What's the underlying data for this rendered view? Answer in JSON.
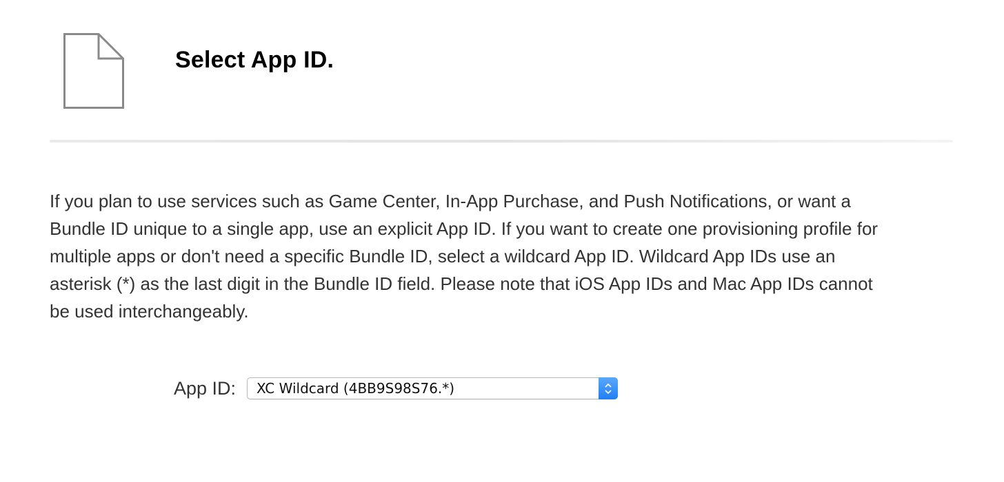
{
  "header": {
    "icon": "document-icon",
    "title": "Select App ID."
  },
  "description": "If you plan to use services such as Game Center, In-App Purchase, and Push Notifications, or want a Bundle ID unique to a single app, use an explicit App ID. If you want to create one provisioning profile for multiple apps or don't need a specific Bundle ID, select a wildcard App ID. Wildcard App IDs use an asterisk (*) as the last digit in the Bundle ID field. Please note that iOS App IDs and Mac App IDs cannot be used interchangeably.",
  "app_id_field": {
    "label": "App ID:",
    "selected": "XC Wildcard (4BB9S98S76.*)",
    "stepper_icon": "up-down-chevron-icon"
  },
  "colors": {
    "accent": "#1f7ff3",
    "title": "#000000",
    "text": "#333333",
    "icon_stroke": "#8a8a8a",
    "divider": "#e6e6e6"
  }
}
